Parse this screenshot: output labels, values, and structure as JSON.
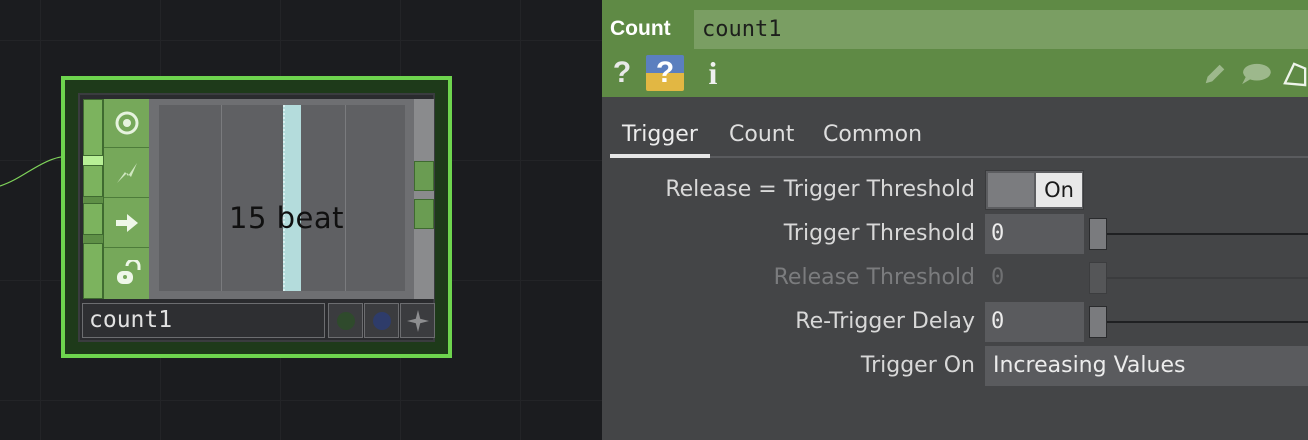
{
  "node": {
    "viewer_text": "15 beat",
    "name": "count1"
  },
  "panel": {
    "op_type": "Count",
    "op_name": "count1",
    "help_icons": [
      "?",
      "?",
      "i"
    ],
    "tabs": [
      {
        "label": "Trigger",
        "active": true
      },
      {
        "label": "Count",
        "active": false
      },
      {
        "label": "Common",
        "active": false
      }
    ],
    "params": {
      "release_eq_trigger": {
        "label": "Release = Trigger Threshold",
        "value": "On"
      },
      "trigger_threshold": {
        "label": "Trigger Threshold",
        "value": "0"
      },
      "release_threshold": {
        "label": "Release Threshold",
        "value": "0"
      },
      "retrigger_delay": {
        "label": "Re-Trigger Delay",
        "value": "0"
      },
      "trigger_on": {
        "label": "Trigger On",
        "value": "Increasing Values"
      }
    }
  },
  "colors": {
    "node_border": "#6ed44e",
    "header_green": "#5f8a45",
    "name_field_green": "#7a9e63"
  },
  "icons": [
    "bypass-icon",
    "lock-flag-icon",
    "arrow-right-icon",
    "unlock-icon",
    "pencil-icon",
    "comment-icon",
    "tag-icon"
  ]
}
